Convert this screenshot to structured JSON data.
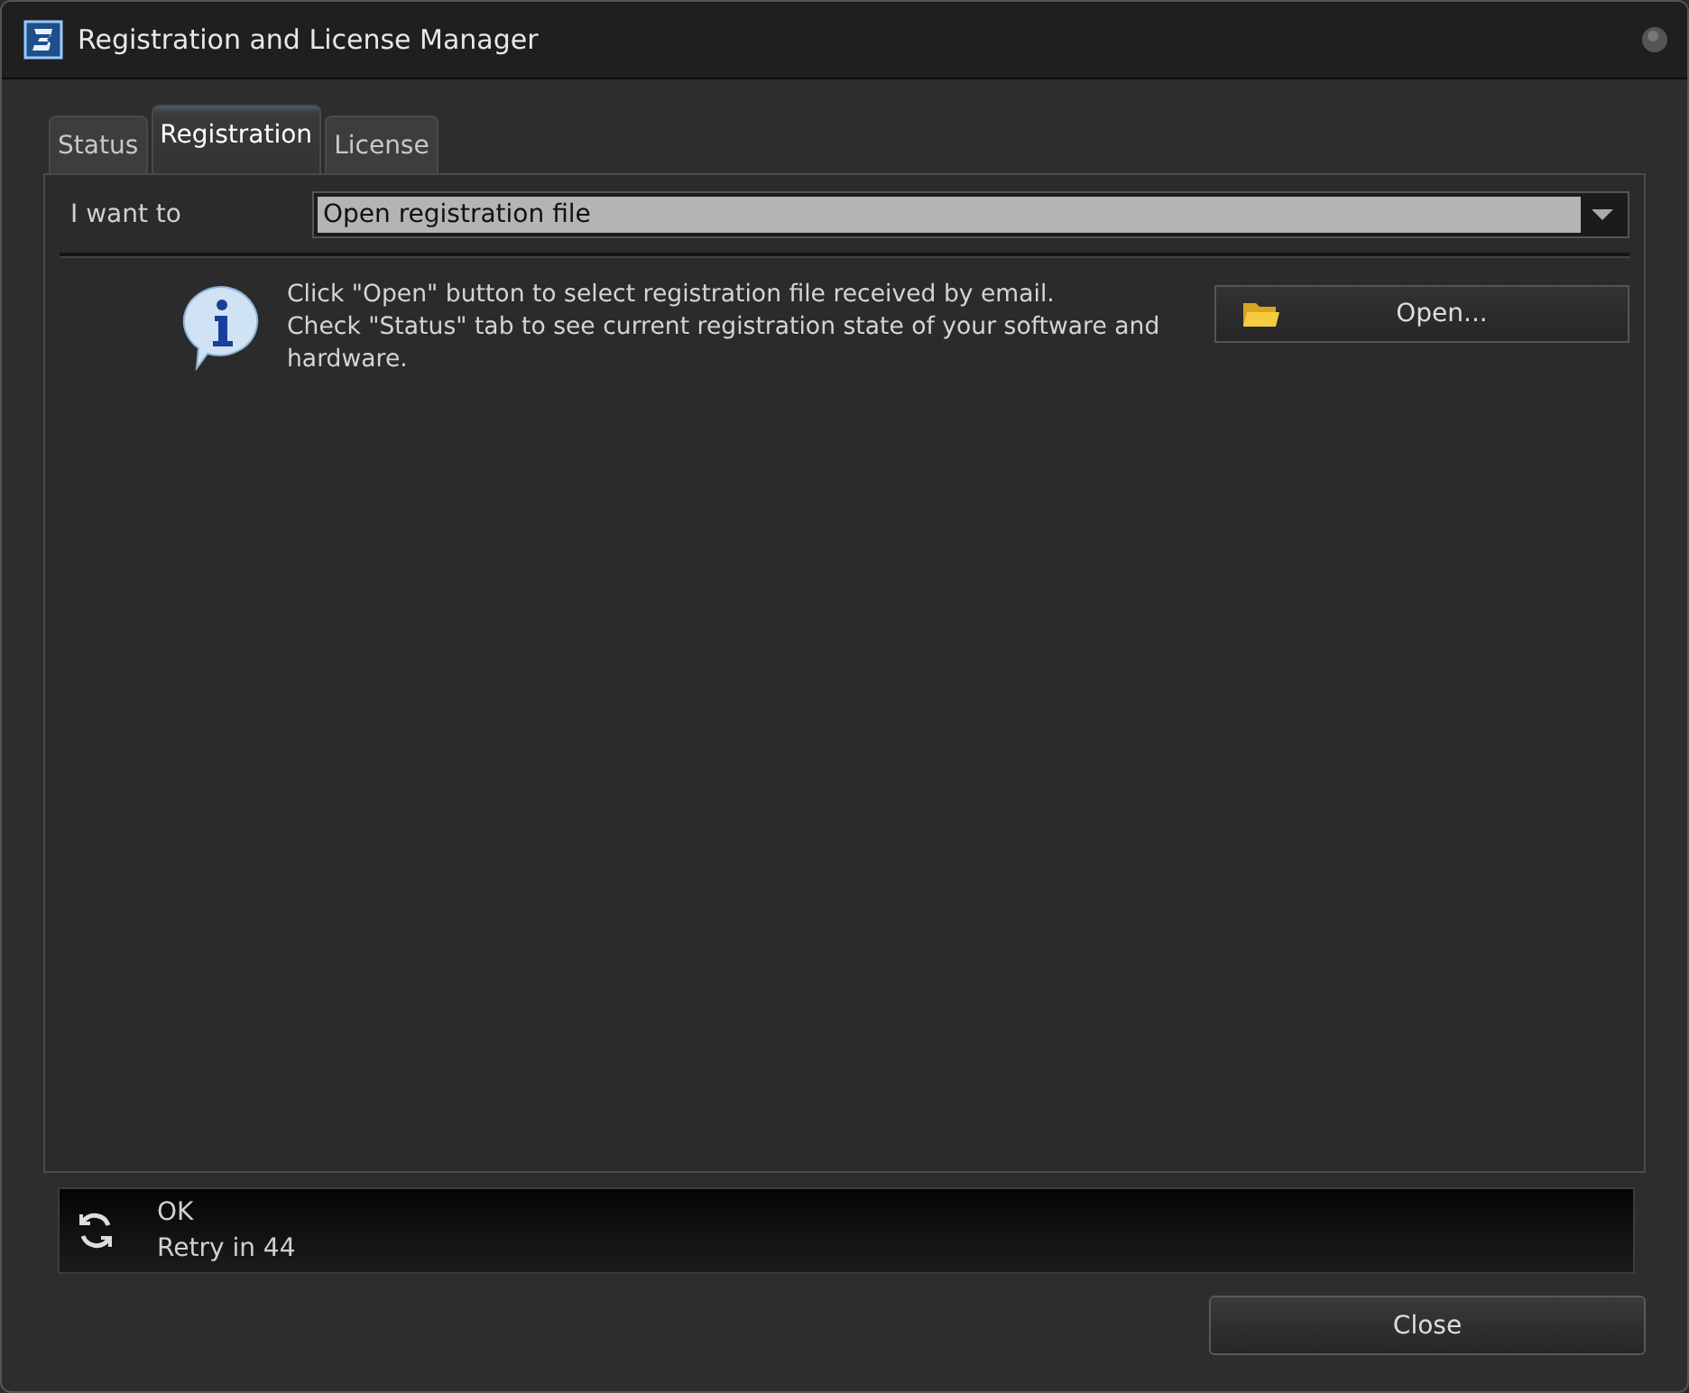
{
  "window": {
    "title": "Registration and License Manager"
  },
  "tabs": [
    {
      "label": "Status",
      "selected": false
    },
    {
      "label": "Registration",
      "selected": true
    },
    {
      "label": "License",
      "selected": false
    }
  ],
  "action": {
    "label": "I want to",
    "value": "Open registration file"
  },
  "info": {
    "lines": [
      "Click \"Open\" button to select registration file received by email.",
      "Check \"Status\" tab to see current registration state of your software and",
      "hardware."
    ],
    "button": "Open..."
  },
  "status_bar": {
    "lines": [
      "OK",
      "Retry in 44"
    ]
  },
  "buttons": [
    "Close"
  ]
}
